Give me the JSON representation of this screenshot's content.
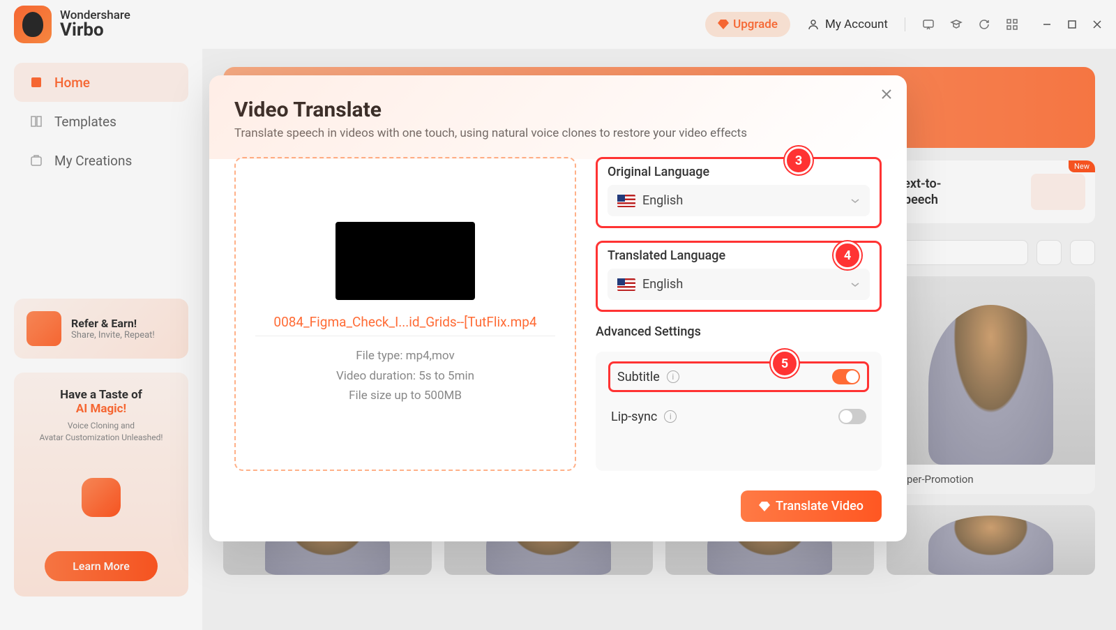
{
  "app": {
    "brand": "Wondershare",
    "product": "Virbo"
  },
  "header": {
    "upgrade": "Upgrade",
    "account": "My Account"
  },
  "sidebar": {
    "items": [
      {
        "label": "Home"
      },
      {
        "label": "Templates"
      },
      {
        "label": "My Creations"
      }
    ],
    "refer": {
      "title": "Refer & Earn!",
      "subtitle": "Share, Invite, Repeat!"
    },
    "aimagic": {
      "line1": "Have a Taste of",
      "line2": "AI Magic!",
      "sub": "Voice Cloning and\nAvatar Customization Unleashed!",
      "button": "Learn More"
    }
  },
  "main": {
    "feature": {
      "tts": "Text-to-\nSpeech",
      "new_badge": "New"
    },
    "avatar_label": "...rper-Promotion"
  },
  "modal": {
    "title": "Video Translate",
    "subtitle": "Translate speech in videos with one touch, using natural voice clones to restore your video effects",
    "file_name": "0084_Figma_Check_I...id_Grids--[TutFlix.mp4",
    "specs": {
      "type": "File type: mp4,mov",
      "duration": "Video duration: 5s to 5min",
      "size": "File size up to  500MB"
    },
    "original": {
      "label": "Original Language",
      "value": "English"
    },
    "translated": {
      "label": "Translated Language",
      "value": "English"
    },
    "advanced": {
      "title": "Advanced Settings",
      "subtitle_label": "Subtitle",
      "lipsync_label": "Lip-sync"
    },
    "callouts": {
      "c3": "3",
      "c4": "4",
      "c5": "5"
    },
    "translate_button": "Translate Video"
  }
}
